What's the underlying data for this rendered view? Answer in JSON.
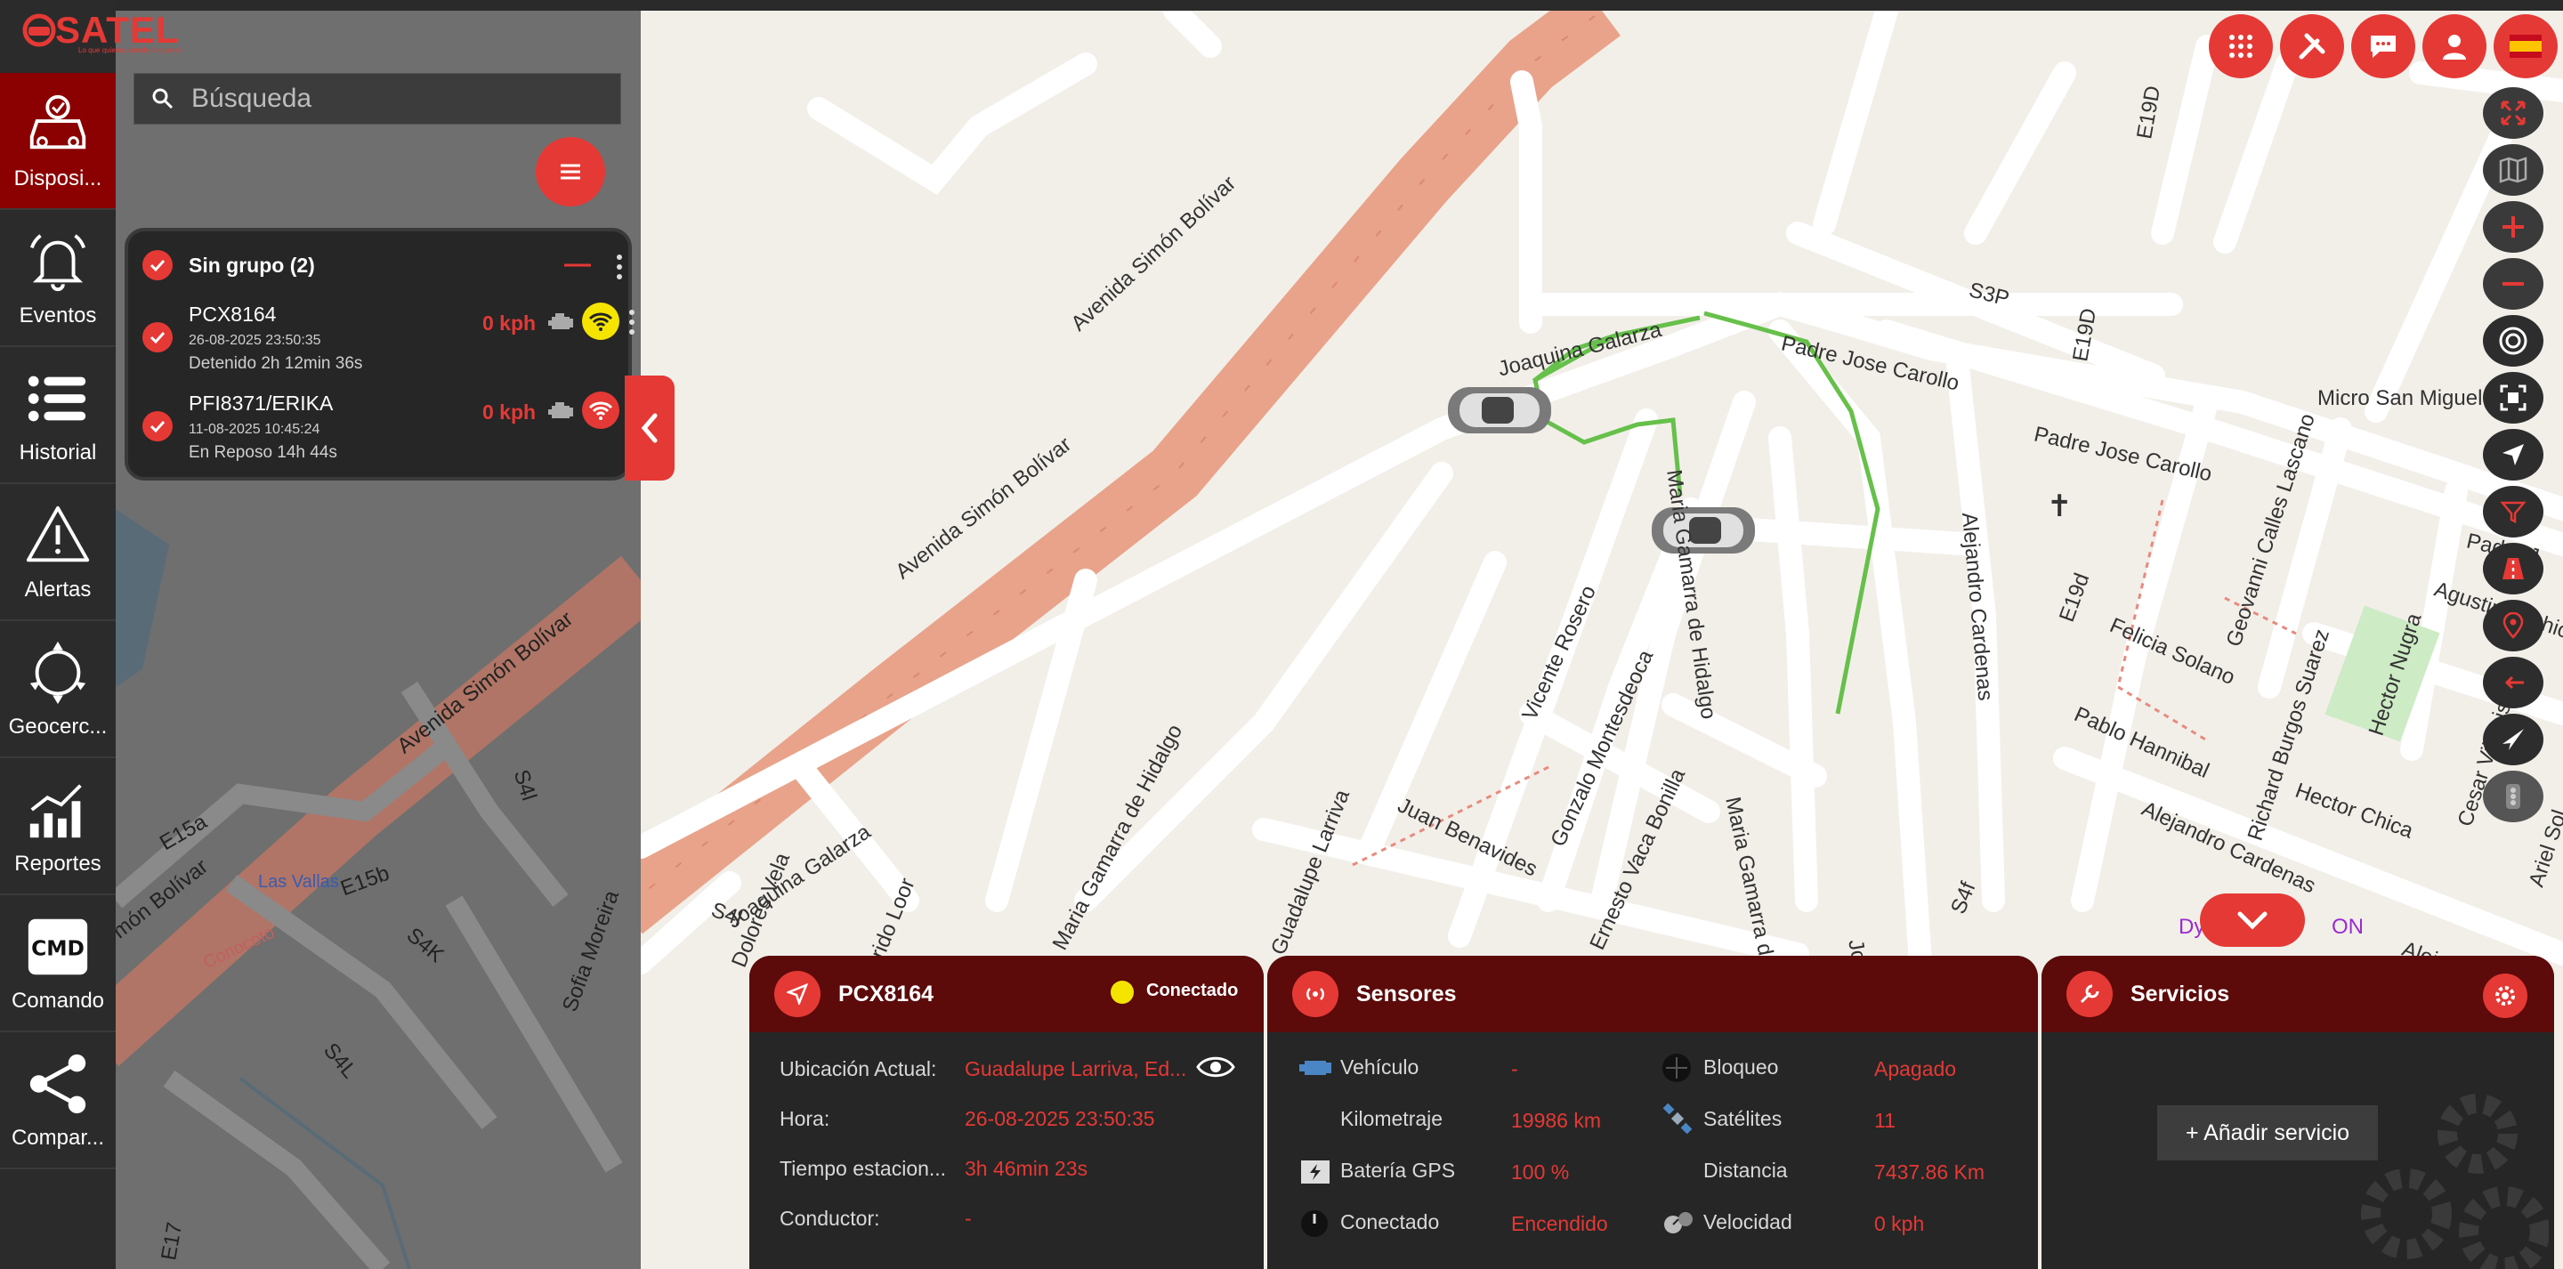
{
  "app": {
    "logo": "SATEL",
    "logo_tagline": "Lo que quieres, donde lo quieres"
  },
  "nav": {
    "items": [
      {
        "label": "Disposi...",
        "icon": "car-icon",
        "active": true
      },
      {
        "label": "Eventos",
        "icon": "bell-icon"
      },
      {
        "label": "Historial",
        "icon": "list-icon"
      },
      {
        "label": "Alertas",
        "icon": "warning-icon"
      },
      {
        "label": "Geocerc...",
        "icon": "geofence-icon"
      },
      {
        "label": "Reportes",
        "icon": "chart-icon"
      },
      {
        "label": "Comando",
        "icon": "cmd-icon"
      },
      {
        "label": "Compar...",
        "icon": "share-icon"
      }
    ]
  },
  "search": {
    "placeholder": "Búsqueda"
  },
  "group": {
    "title": "Sin grupo (2)",
    "vehicles": [
      {
        "name": "PCX8164",
        "time": "26-08-2025 23:50:35",
        "status": "Detenido 2h 12min 36s",
        "speed": "0 kph",
        "signal_color": "#f5e400"
      },
      {
        "name": "PFI8371/ERIKA",
        "time": "11-08-2025 10:45:24",
        "status": "En Reposo 14h 44s",
        "speed": "0 kph",
        "signal_color": "#e53935"
      }
    ]
  },
  "map": {
    "streets": {
      "avenida1": "Avenida Simón Bolívar",
      "avenida2": "Avenida Simón Bolívar",
      "avenida3": "Avenida Simón Bolívar",
      "avenida4": "món Bolívar",
      "joaquina1": "Joaquina Galarza",
      "joaquina2": "Joaquina Galarza",
      "padre1": "Padre Jose Carollo",
      "padre2": "Padre Jose Carollo",
      "padre3": "Padre J",
      "s3p": "S3P",
      "e19d_1": "E19D",
      "e19d_2": "E19D",
      "e19d_3": "E19d",
      "micro": "Micro San Miguel",
      "alejandro": "Alejandro Cardenas",
      "alejandro2": "Alejandro Cardenas",
      "alejandro3": "Alejand",
      "geovanni": "Geovanni Calles Lascano",
      "agustin": "Agustin Anchico",
      "felicia": "Felicia Solano",
      "pablo": "Pablo Hannibal",
      "richard": "Richard Burgos Suarez",
      "hector": "Hector Nugra",
      "hector2": "Hector Chica",
      "cesar": "Cesar Villacis",
      "ariel": "Ariel Sol",
      "maria1": "Maria Gamarra de Hidalgo",
      "maria2": "Maria Gamarra de Hidalgo",
      "maria3": "Maria Gamarra de Hi",
      "vicente": "Vicente Rosero",
      "gonzalo": "Gonzalo Montesdeoca",
      "ernesto": "Ernesto Vaca Bonilla",
      "juan": "Juan Benavides",
      "guadalupe": "Guadalupe Larriva",
      "dolores": "Dolores Vela",
      "loor": "rido Loor",
      "s4l_1": "S4l",
      "s4l_2": "S4l",
      "s4f": "S4f",
      "joaq_b": "Joaq",
      "dy": "Dy",
      "on": "ON",
      "e15a": "E15a",
      "e15b": "E15b",
      "s4k": "S4K",
      "s4l_3": "S4L",
      "sofia": "Sofia Moreira",
      "lasvallas": "Las Vallas",
      "conocoto": "Conocoto",
      "e17": "E17"
    }
  },
  "topright": {
    "buttons": [
      "apps-icon",
      "tools-icon",
      "chat-icon",
      "user-icon",
      "flag-es-icon"
    ]
  },
  "vehicle_card": {
    "title": "PCX8164",
    "connection": "Conectado",
    "rows": [
      {
        "label": "Ubicación Actual:",
        "value": "Guadalupe Larriva, Ed..."
      },
      {
        "label": "Hora:",
        "value": "26-08-2025 23:50:35"
      },
      {
        "label": "Tiempo estacion...",
        "value": "3h 46min 23s"
      },
      {
        "label": "Conductor:",
        "value": "-"
      }
    ]
  },
  "sensors_card": {
    "title": "Sensores",
    "left": [
      {
        "label": "Vehículo",
        "value": "-",
        "icon": "engine-icon"
      },
      {
        "label": "Kilometraje",
        "value": "19986 km"
      },
      {
        "label": "Batería GPS",
        "value": "100 %",
        "icon": "battery-icon"
      },
      {
        "label": "Conectado",
        "value": "Encendido",
        "icon": "power-icon"
      }
    ],
    "right": [
      {
        "label": "Bloqueo",
        "value": "Apagado",
        "icon": "lock-icon"
      },
      {
        "label": "Satélites",
        "value": "11",
        "icon": "satellite-icon"
      },
      {
        "label": "Distancia",
        "value": "7437.86 Km"
      },
      {
        "label": "Velocidad",
        "value": "0 kph",
        "icon": "gauge-icon"
      }
    ]
  },
  "services_card": {
    "title": "Servicios",
    "add_label": "+ Añadir servicio"
  },
  "colors": {
    "accent": "#e53935",
    "dark_red": "#5c0a0a",
    "route": "#66c04a",
    "avenue": "#e9a38a"
  }
}
